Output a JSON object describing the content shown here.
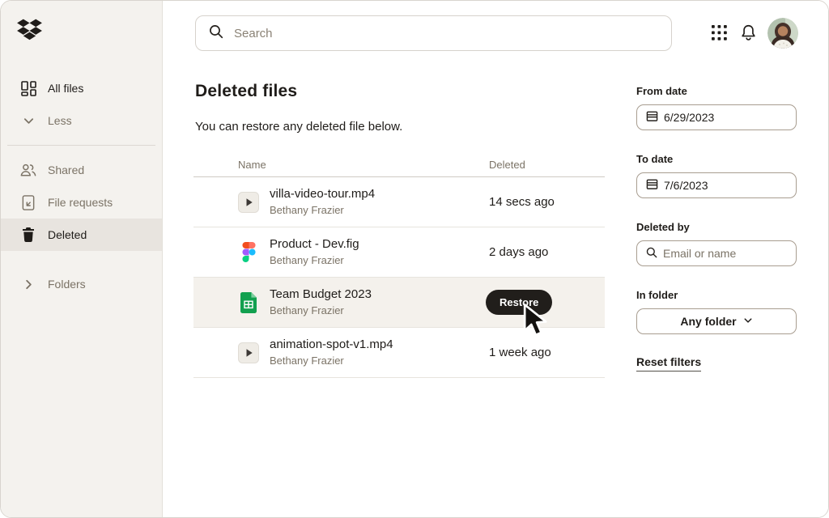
{
  "app": {
    "name": "Dropbox"
  },
  "colors": {
    "accent_dark": "#211e1b",
    "sidebar_bg": "#f4f2ee",
    "active_item_bg": "#e8e4df",
    "highlight_row_bg": "#f4f1ec",
    "muted_text": "#7b7366",
    "figma": [
      "#f24e1e",
      "#ff7262",
      "#a259ff",
      "#1abcfe",
      "#0acf83"
    ],
    "sheet_green": "#12a04f"
  },
  "sidebar": {
    "items": [
      {
        "label": "All files",
        "icon": "all-files-icon",
        "active": false,
        "muted": false
      },
      {
        "label": "Less",
        "icon": "chevron-down-icon",
        "muted": true
      },
      {
        "divider": true
      },
      {
        "label": "Shared",
        "icon": "people-icon",
        "muted": true
      },
      {
        "label": "File requests",
        "icon": "file-request-icon",
        "muted": true
      },
      {
        "label": "Deleted",
        "icon": "trash-icon",
        "active": true
      },
      {
        "label": "Folders",
        "icon": "chevron-right-icon",
        "muted": true,
        "spaced": true
      }
    ]
  },
  "header": {
    "search_placeholder": "Search"
  },
  "main": {
    "title": "Deleted files",
    "subtitle": "You can restore any deleted file below.",
    "table": {
      "columns": [
        "Name",
        "Deleted"
      ],
      "rows": [
        {
          "icon": "video-file-icon",
          "name": "villa-video-tour.mp4",
          "owner": "Bethany Frazier",
          "deleted": "14 secs ago"
        },
        {
          "icon": "figma-file-icon",
          "name": "Product - Dev.fig",
          "owner": "Bethany Frazier",
          "deleted": "2 days ago"
        },
        {
          "icon": "spreadsheet-file-icon",
          "name": "Team Budget 2023",
          "owner": "Bethany Frazier",
          "deleted": "",
          "action": "Restore",
          "highlighted": true
        },
        {
          "icon": "video-file-icon",
          "name": "animation-spot-v1.mp4",
          "owner": "Bethany Frazier",
          "deleted": "1 week ago"
        }
      ]
    }
  },
  "filters": {
    "from_date": {
      "label": "From date",
      "value": "6/29/2023"
    },
    "to_date": {
      "label": "To date",
      "value": "7/6/2023"
    },
    "deleted_by": {
      "label": "Deleted by",
      "placeholder": "Email or name"
    },
    "in_folder": {
      "label": "In folder",
      "value": "Any folder"
    },
    "reset_label": "Reset filters"
  }
}
